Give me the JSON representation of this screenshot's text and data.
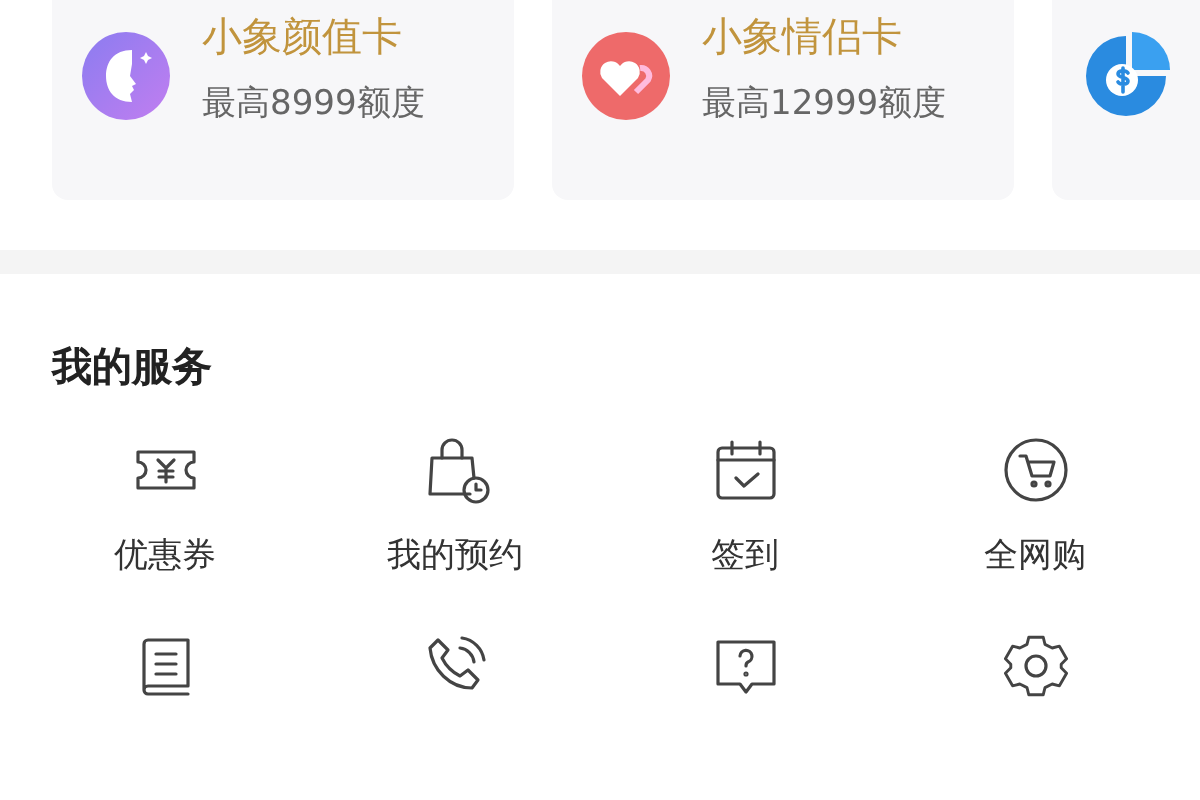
{
  "cards": [
    {
      "title": "小象颜值卡",
      "subtitle": "最高8999额度"
    },
    {
      "title": "小象情侣卡",
      "subtitle": "最高12999额度"
    }
  ],
  "more_cards": true,
  "services": {
    "title": "我的服务",
    "items": [
      {
        "label": "优惠券"
      },
      {
        "label": "我的预约"
      },
      {
        "label": "签到"
      },
      {
        "label": "全网购"
      }
    ],
    "more_items": true
  }
}
